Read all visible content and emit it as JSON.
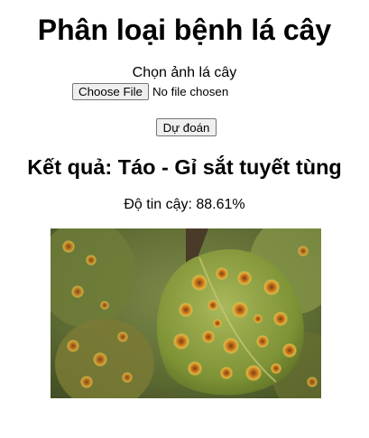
{
  "title": "Phân loại bệnh lá cây",
  "upload": {
    "label": "Chọn ảnh lá cây",
    "button_label": "Choose File",
    "status": "No file chosen"
  },
  "predict_button": "Dự đoán",
  "result": {
    "text": "Kết quả: Táo - Gỉ sắt tuyết tùng",
    "confidence": "Độ tin cậy: 88.61%"
  },
  "colors": {
    "background": "#ffffff",
    "text": "#000000",
    "button_bg": "#efefef",
    "button_border": "#767676"
  }
}
